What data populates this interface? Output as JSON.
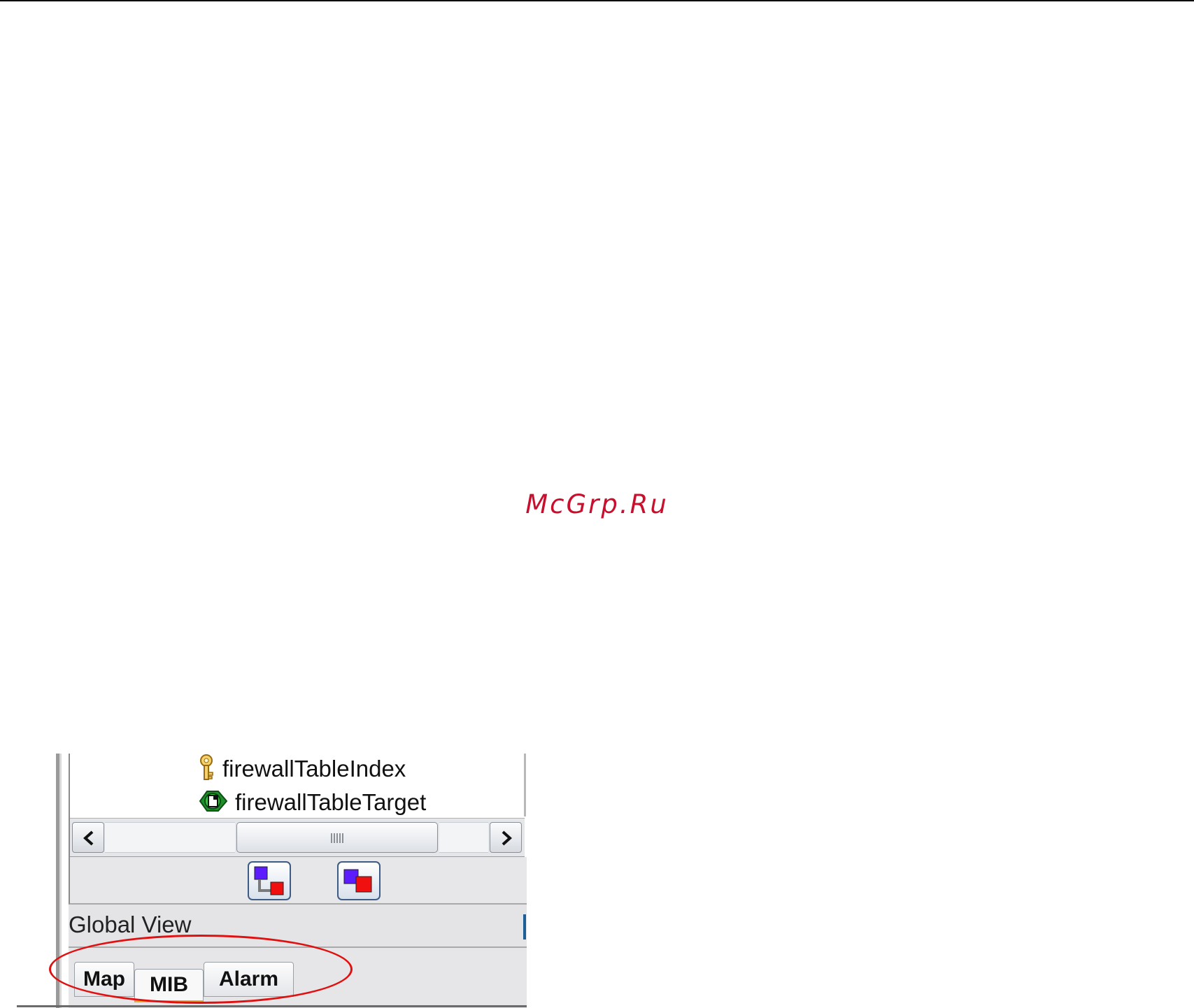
{
  "watermark": "McGrp.Ru",
  "tree": {
    "items": [
      {
        "label": "firewallTableIndex",
        "icon": "key-icon"
      },
      {
        "label": "firewallTableTarget",
        "icon": "green-object-icon"
      }
    ]
  },
  "scrollbar": {
    "left_icon": "chevron-left-icon",
    "right_icon": "chevron-right-icon"
  },
  "toolbar": {
    "buttons": [
      {
        "icon": "hierarchy-view-icon"
      },
      {
        "icon": "overlap-view-icon"
      }
    ]
  },
  "panel": {
    "title": "Global View"
  },
  "tabs": [
    {
      "label": "Map"
    },
    {
      "label": "MIB"
    },
    {
      "label": "Alarm"
    }
  ],
  "selected_tab": "MIB",
  "colors": {
    "highlight": "#e01010",
    "watermark": "#c8102e",
    "selected_tab_accent": "#f0a732"
  }
}
